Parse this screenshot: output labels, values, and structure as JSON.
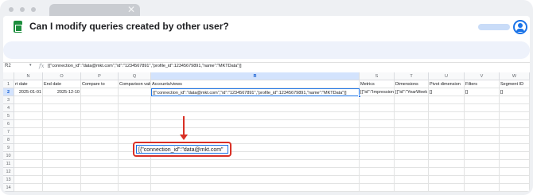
{
  "browser": {
    "tab_close_glyph": "✕"
  },
  "document": {
    "title": "Can I modify queries created by other user?"
  },
  "formula_bar": {
    "cell_ref": "R2",
    "caret": "▾",
    "fx": "fx",
    "value": "[{\"connection_id\":\"data@mkt.com\",\"id\":\"1234567891\",\"profile_id\":12345679891,\"name\":\"MKTData\"}]"
  },
  "grid": {
    "columns": [
      "N",
      "O",
      "P",
      "Q",
      "R",
      "S",
      "T",
      "U",
      "V",
      "W"
    ],
    "selected_column": "R",
    "rows": [
      "1",
      "2",
      "3",
      "4",
      "5",
      "6",
      "7",
      "8",
      "9",
      "10",
      "11",
      "12",
      "13",
      "14"
    ],
    "selected_row": "2",
    "header_row": [
      "rt date",
      "End date",
      "Compare to",
      "Comparison valu",
      "Accounts/views",
      "Metrics",
      "Dimensions",
      "Pivot dimension",
      "Filters",
      "Segment ID"
    ],
    "data_row": [
      "2025-01-01",
      "2025-12-10",
      "",
      "",
      "[{\"connection_id\":\"data@mkt.com\",\"id\":\"1234567891\",\"profile_id\":12345679891,\"name\":\"MKTData\"}]",
      "[{\"id\":\"Impression",
      "[{\"id\":\"YearWeek",
      "[]",
      "[]",
      "[]"
    ]
  },
  "callout": {
    "text": "[{\"connection_id\":\"data@mkt.com\""
  },
  "colors": {
    "accent": "#1a73e8",
    "highlight": "#d93025",
    "sheets_green": "#1e8e3e"
  }
}
